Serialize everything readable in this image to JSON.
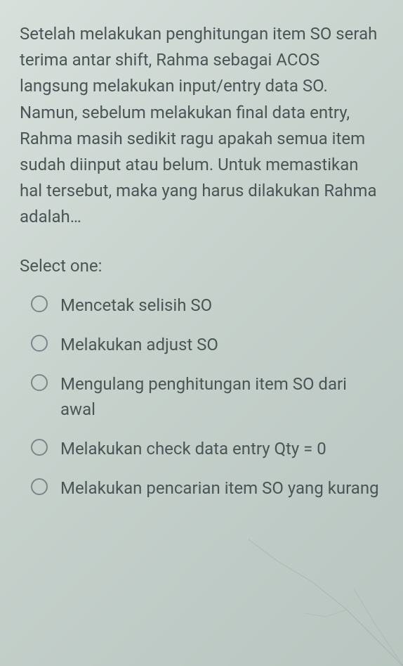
{
  "question": "Setelah melakukan penghitungan item SO serah terima antar shift, Rahma sebagai ACOS langsung melakukan input/entry data SO. Namun, sebelum melakukan final data entry, Rahma masih sedikit ragu apakah semua item sudah diinput atau belum. Untuk memastikan hal tersebut, maka yang harus dilakukan Rahma adalah…",
  "selectLabel": "Select one:",
  "options": [
    {
      "label": "Mencetak selisih SO"
    },
    {
      "label": "Melakukan adjust SO"
    },
    {
      "label": "Mengulang penghitungan item SO dari awal"
    },
    {
      "label": "Melakukan check data entry Qty = 0"
    },
    {
      "label": "Melakukan pencarian item SO yang kurang"
    }
  ]
}
